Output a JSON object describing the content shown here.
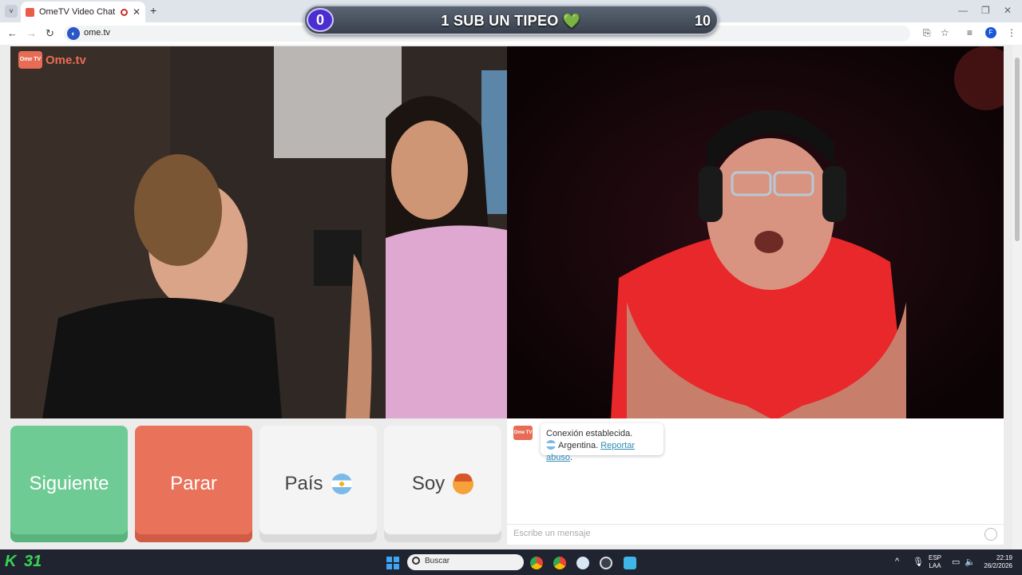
{
  "browser": {
    "tab_title": "OmeTV Video Chat — Omegle Alternative",
    "url": "ome.tv",
    "profile_initial": "F"
  },
  "banner": {
    "left_counter": "0",
    "title": "1 SUB UN TIPEO",
    "heart": "💚",
    "right_counter": "10"
  },
  "ometv": {
    "logo_badge": "Ome TV",
    "logo_text": "Ome.tv",
    "buttons": {
      "next": "Siguiente",
      "stop": "Parar",
      "country": "País",
      "gender": "Soy"
    },
    "chat": {
      "status": "Conexión establecida.",
      "country": "Argentina.",
      "report": "Reportar abuso",
      "report_end": ".",
      "input_placeholder": "Escribe un mensaje"
    }
  },
  "taskbar": {
    "k_logo": "K",
    "k_number": "31",
    "search_placeholder": "Buscar",
    "lang_top": "ESP",
    "lang_bottom": "LAA",
    "time": "22:19",
    "date": "26/2/2026"
  },
  "colors": {
    "next": "#6fcb94",
    "stop": "#e9725b",
    "neutral": "#f4f4f4",
    "banner_bg": "#39414d",
    "banner_badge": "#4a2ed0",
    "taskbar": "#1f2430"
  }
}
